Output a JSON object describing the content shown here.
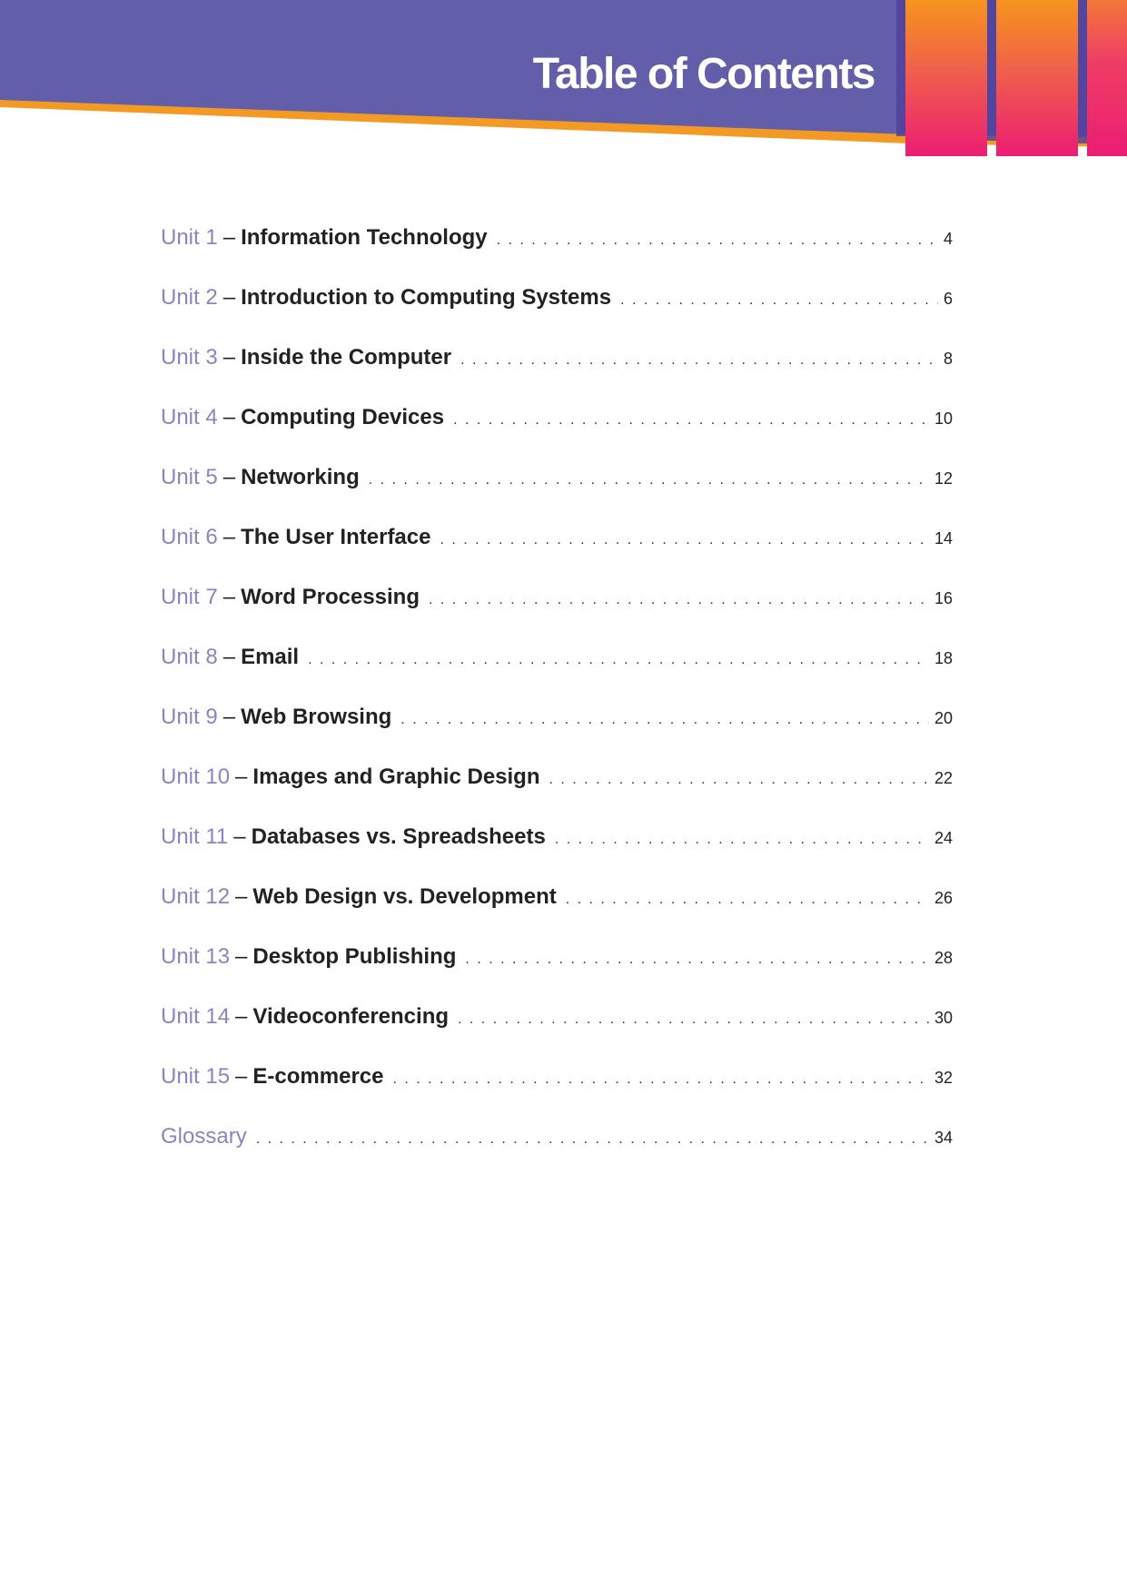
{
  "header": {
    "title": "Table of Contents",
    "colors": {
      "band": "#625ea9",
      "band_edge": "#f39a25",
      "stripe_top": "#f7941d",
      "stripe_bottom": "#ec1d73"
    }
  },
  "toc": {
    "entries": [
      {
        "label": "Unit 1",
        "separator": "–",
        "title": "Information Technology",
        "page": "4"
      },
      {
        "label": "Unit 2",
        "separator": "–",
        "title": "Introduction to Computing Systems",
        "page": "6"
      },
      {
        "label": "Unit 3",
        "separator": "–",
        "title": "Inside the Computer",
        "page": "8"
      },
      {
        "label": "Unit 4",
        "separator": "–",
        "title": "Computing Devices",
        "page": "10"
      },
      {
        "label": "Unit 5",
        "separator": "–",
        "title": "Networking",
        "page": "12"
      },
      {
        "label": "Unit 6",
        "separator": "–",
        "title": "The User Interface",
        "page": "14"
      },
      {
        "label": "Unit 7",
        "separator": "–",
        "title": "Word Processing",
        "page": "16"
      },
      {
        "label": "Unit 8",
        "separator": "–",
        "title": "Email",
        "page": "18"
      },
      {
        "label": "Unit 9",
        "separator": "–",
        "title": "Web Browsing",
        "page": "20"
      },
      {
        "label": "Unit 10",
        "separator": "–",
        "title": "Images and Graphic Design",
        "page": "22"
      },
      {
        "label": "Unit 11",
        "separator": "–",
        "title": "Databases vs. Spreadsheets",
        "page": "24"
      },
      {
        "label": "Unit 12",
        "separator": "–",
        "title": "Web Design vs. Development",
        "page": "26"
      },
      {
        "label": "Unit 13",
        "separator": "–",
        "title": "Desktop Publishing",
        "page": "28"
      },
      {
        "label": "Unit 14",
        "separator": "–",
        "title": "Videoconferencing",
        "page": "30"
      },
      {
        "label": "Unit 15",
        "separator": "–",
        "title": "E-commerce",
        "page": "32"
      },
      {
        "label": "Glossary",
        "separator": "",
        "title": "",
        "page": "34"
      }
    ]
  }
}
